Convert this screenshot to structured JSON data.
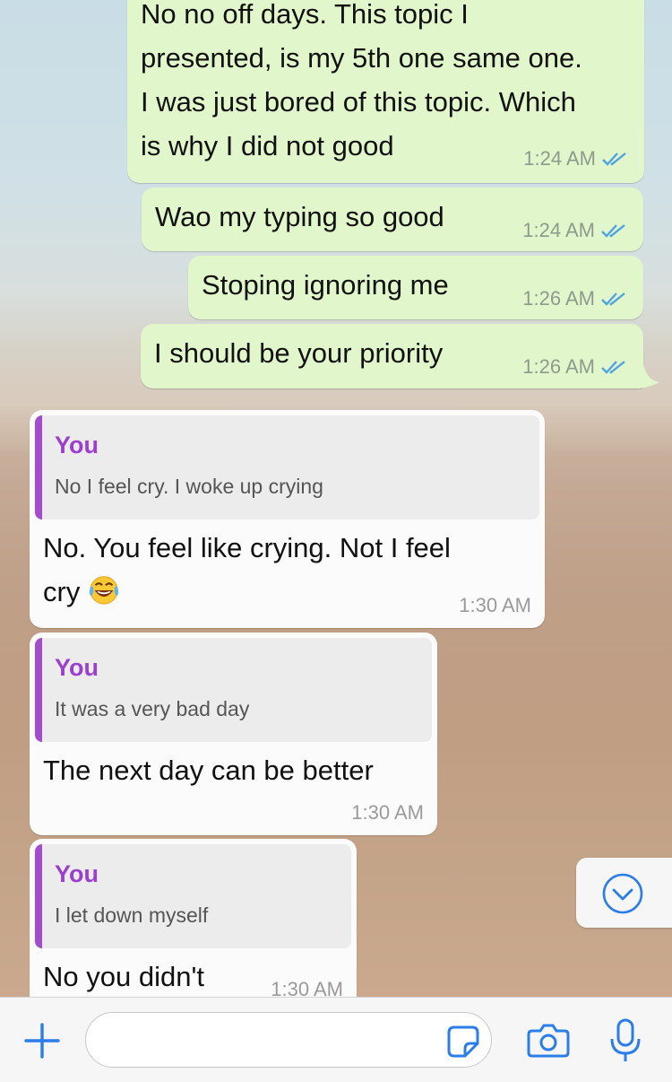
{
  "colors": {
    "outgoing_bubble": "#e1f7cb",
    "incoming_bubble": "#fbfbfb",
    "quote_accent": "#a54bd0",
    "read_ticks": "#4fa3e0",
    "ios_blue": "#2b7de9"
  },
  "messages": [
    {
      "direction": "outgoing",
      "text_lines": [
        "No no off days. This topic I",
        "presented, is my 5th one same one.",
        "I was just bored of this topic. Which",
        "is why I did not good"
      ],
      "time": "1:24 AM",
      "status": "read"
    },
    {
      "direction": "outgoing",
      "text": "Wao my typing so good",
      "time": "1:24 AM",
      "status": "read"
    },
    {
      "direction": "outgoing",
      "text": "Stoping ignoring me",
      "time": "1:26 AM",
      "status": "read"
    },
    {
      "direction": "outgoing",
      "text": "I should be your priority",
      "time": "1:26 AM",
      "status": "read"
    },
    {
      "direction": "incoming",
      "quote": {
        "author": "You",
        "text": "No I feel cry. I woke up crying"
      },
      "text_lines": [
        "No. You feel like crying. Not I feel",
        "cry"
      ],
      "emoji": "face-with-tears-of-joy",
      "time": "1:30 AM"
    },
    {
      "direction": "incoming",
      "quote": {
        "author": "You",
        "text": "It was a very bad day"
      },
      "text": "The next day can be better",
      "time": "1:30 AM"
    },
    {
      "direction": "incoming",
      "quote": {
        "author": "You",
        "text": "I let down myself"
      },
      "text": "No you didn't",
      "time": "1:30 AM"
    }
  ],
  "composer": {
    "input_value": "",
    "input_placeholder": "",
    "icons": [
      "plus-icon",
      "sticker-icon",
      "camera-icon",
      "microphone-icon"
    ]
  },
  "scroll_down_icon": "chevron-down-circle-icon"
}
